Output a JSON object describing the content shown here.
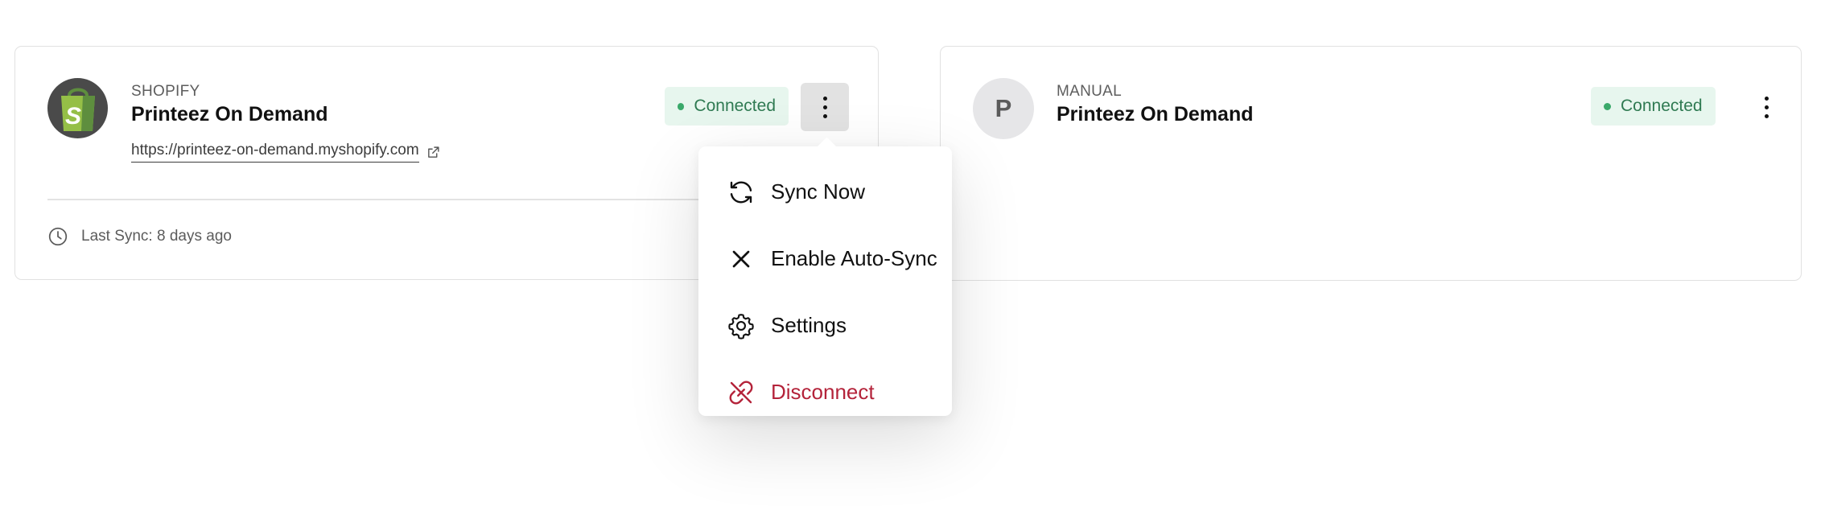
{
  "integrations": [
    {
      "platform": "SHOPIFY",
      "store_name": "Printeez On Demand",
      "store_url": "https://printeez-on-demand.myshopify.com",
      "status": "Connected",
      "last_sync": "Last Sync: 8 days ago",
      "logo_letter": "S"
    },
    {
      "platform": "MANUAL",
      "store_name": "Printeez On Demand",
      "status": "Connected",
      "avatar_letter": "P"
    }
  ],
  "menu": {
    "items": [
      {
        "label": "Sync Now",
        "icon": "sync-icon"
      },
      {
        "label": "Enable Auto-Sync",
        "icon": "close-icon"
      },
      {
        "label": "Settings",
        "icon": "gear-icon"
      },
      {
        "label": "Disconnect",
        "icon": "unlink-icon"
      }
    ]
  },
  "colors": {
    "connected_badge_bg": "#e7f6ee",
    "connected_text": "#2f7a52",
    "connected_dot": "#3aa96a",
    "danger": "#b4233a",
    "shopify_green": "#95bf47"
  }
}
